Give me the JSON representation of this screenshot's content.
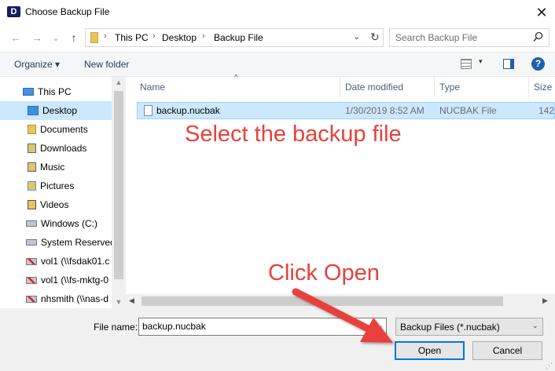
{
  "window": {
    "logo_letter": "D",
    "title": "Choose Backup File",
    "close_glyph": "✕"
  },
  "nav_buttons": {
    "back": "←",
    "forward": "→",
    "recent": "⌄",
    "up": "↑"
  },
  "address": {
    "crumbs": [
      "This PC",
      "Desktop",
      "Backup File"
    ],
    "separator": "›",
    "dropdown": "⌄",
    "refresh": "↻"
  },
  "search": {
    "placeholder": "Search Backup File",
    "icon": "search-icon"
  },
  "toolbar": {
    "organize_label": "Organize ▾",
    "new_folder_label": "New folder",
    "view_dropdown": "▾",
    "help": "?"
  },
  "nav_pane": {
    "items": [
      {
        "label": "This PC",
        "icon": "computer-icon",
        "selected": false
      },
      {
        "label": "Desktop",
        "icon": "desktop-icon",
        "selected": true
      },
      {
        "label": "Documents",
        "icon": "documents-icon",
        "selected": false
      },
      {
        "label": "Downloads",
        "icon": "downloads-icon",
        "selected": false
      },
      {
        "label": "Music",
        "icon": "music-icon",
        "selected": false
      },
      {
        "label": "Pictures",
        "icon": "pictures-icon",
        "selected": false
      },
      {
        "label": "Videos",
        "icon": "videos-icon",
        "selected": false
      },
      {
        "label": "Windows (C:)",
        "icon": "drive-icon",
        "selected": false
      },
      {
        "label": "System Reserved",
        "icon": "drive-icon",
        "selected": false
      },
      {
        "label": "vol1 (\\\\fsdak01.c",
        "icon": "network-drive-disconnected-icon",
        "selected": false
      },
      {
        "label": "vol1 (\\\\fs-mktg-0",
        "icon": "network-drive-disconnected-icon",
        "selected": false
      },
      {
        "label": "nhsmith (\\\\nas-d",
        "icon": "network-drive-disconnected-icon",
        "selected": false
      }
    ]
  },
  "file_list": {
    "columns": {
      "name": "Name",
      "date": "Date modified",
      "type": "Type",
      "size": "Size"
    },
    "sort_caret": "^",
    "rows": [
      {
        "name": "backup.nucbak",
        "date": "1/30/2019 8:52 AM",
        "type": "NUCBAK File",
        "size": "142",
        "selected": true
      }
    ]
  },
  "bottom": {
    "filename_label": "File name:",
    "filename_value": "backup.nucbak",
    "filetype_value": "Backup Files (*.nucbak)",
    "dropdown": "⌄",
    "open_label": "Open",
    "cancel_label": "Cancel"
  },
  "annotations": {
    "select_text": "Select the backup file",
    "open_text": "Click Open",
    "color": "#e8413c"
  },
  "colors": {
    "selection": "#cce8ff",
    "accent": "#0078d7",
    "chrome": "#f0f0f0"
  }
}
